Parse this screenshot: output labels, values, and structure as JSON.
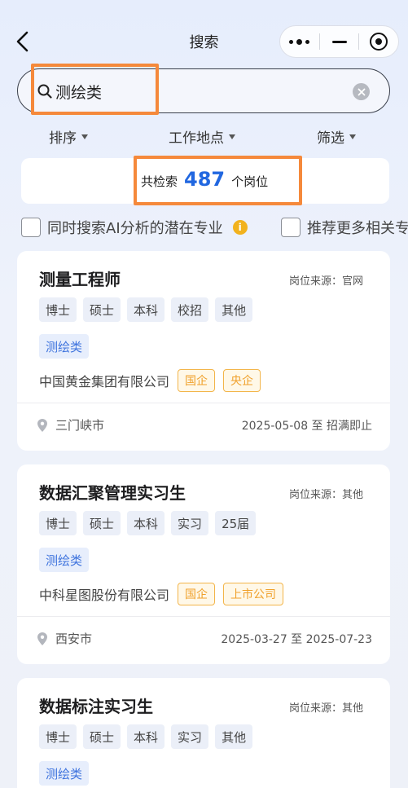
{
  "nav": {
    "title": "搜索"
  },
  "search": {
    "query": "测绘类"
  },
  "filters": [
    {
      "label": "排序"
    },
    {
      "label": "工作地点"
    },
    {
      "label": "筛选"
    }
  ],
  "results": {
    "prefix": "共检索",
    "count": "487",
    "suffix": "个岗位"
  },
  "options": [
    {
      "label": "同时搜索AI分析的潜在专业"
    },
    {
      "label": "推荐更多相关专业"
    }
  ],
  "jobs": [
    {
      "title": "测量工程师",
      "source": "岗位来源：官网",
      "chips": [
        "博士",
        "硕士",
        "本科",
        "校招",
        "其他"
      ],
      "major": "测绘类",
      "company": "中国黄金集团有限公司",
      "tags": [
        "国企",
        "央企"
      ],
      "location": "三门峡市",
      "date": "2025-05-08 至 招满即止"
    },
    {
      "title": "数据汇聚管理实习生",
      "source": "岗位来源：其他",
      "chips": [
        "博士",
        "硕士",
        "本科",
        "实习",
        "25届"
      ],
      "major": "测绘类",
      "company": "中科星图股份有限公司",
      "tags": [
        "国企",
        "上市公司"
      ],
      "location": "西安市",
      "date": "2025-03-27 至 2025-07-23"
    },
    {
      "title": "数据标注实习生",
      "source": "岗位来源：其他",
      "chips": [
        "博士",
        "硕士",
        "本科",
        "实习",
        "其他"
      ],
      "major": "测绘类"
    }
  ],
  "colors": {
    "accent": "#2167e0",
    "highlight": "#f5893b",
    "tag": "#f0a12c",
    "major": "#3f74de"
  }
}
